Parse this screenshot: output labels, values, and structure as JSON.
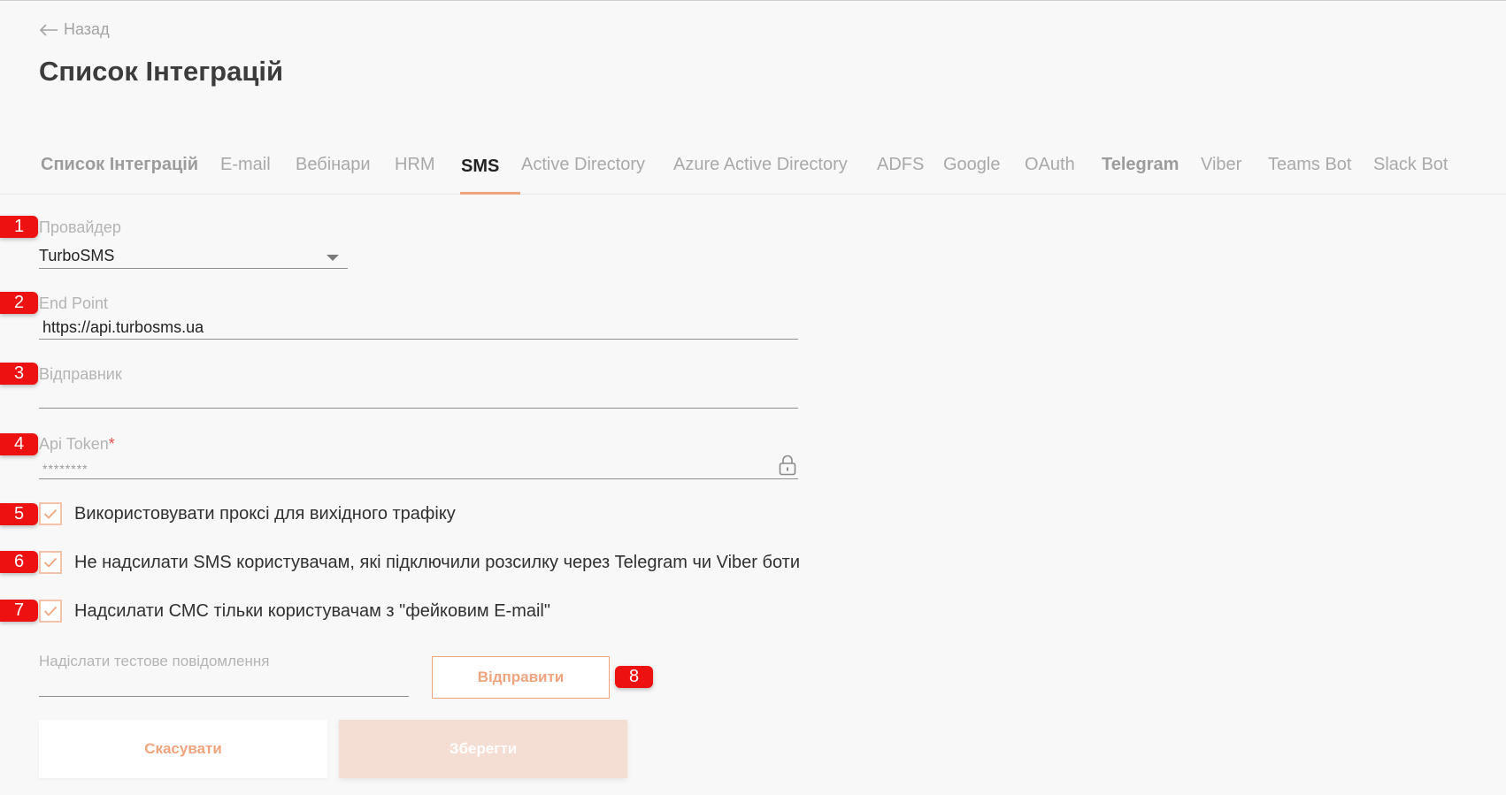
{
  "header": {
    "back_label": "Назад",
    "title": "Список Інтеграцій"
  },
  "tabs": [
    {
      "label": "Список Інтеграцій",
      "state": "bold"
    },
    {
      "label": "E-mail",
      "state": "normal"
    },
    {
      "label": "Вебінари",
      "state": "normal"
    },
    {
      "label": "HRM",
      "state": "normal"
    },
    {
      "label": "SMS",
      "state": "active"
    },
    {
      "label": "Active Directory",
      "state": "normal"
    },
    {
      "label": "Azure Active Directory",
      "state": "normal"
    },
    {
      "label": "ADFS",
      "state": "normal"
    },
    {
      "label": "Google",
      "state": "normal"
    },
    {
      "label": "OAuth",
      "state": "normal"
    },
    {
      "label": "Telegram",
      "state": "bold"
    },
    {
      "label": "Viber",
      "state": "normal"
    },
    {
      "label": "Teams Bot",
      "state": "normal"
    },
    {
      "label": "Slack Bot",
      "state": "normal"
    }
  ],
  "badges": [
    "1",
    "2",
    "3",
    "4",
    "5",
    "6",
    "7",
    "8"
  ],
  "form": {
    "provider": {
      "label": "Провайдер",
      "value": "TurboSMS"
    },
    "endpoint": {
      "label": "End Point",
      "value": "https://api.turbosms.ua"
    },
    "sender": {
      "label": "Відправник",
      "value": ""
    },
    "api_token": {
      "label": "Api Token",
      "required_mark": "*",
      "value": "********"
    },
    "checkboxes": [
      {
        "label": "Використовувати проксі для вихідного трафіку",
        "checked": true
      },
      {
        "label": "Не надсилати SMS користувачам, які підключили розсилку через Telegram чи Viber боти",
        "checked": true
      },
      {
        "label": "Надсилати СМС тільки користувачам з \"фейковим E-mail\"",
        "checked": true
      }
    ],
    "test_message": {
      "label": "Надіслати тестове повідомлення",
      "value": ""
    },
    "send_button": "Відправити",
    "cancel_button": "Скасувати",
    "save_button": "Зберегти"
  },
  "colors": {
    "accent": "#f0a47e",
    "badge": "#ee1111",
    "save_disabled_bg": "#f4ddd2"
  }
}
